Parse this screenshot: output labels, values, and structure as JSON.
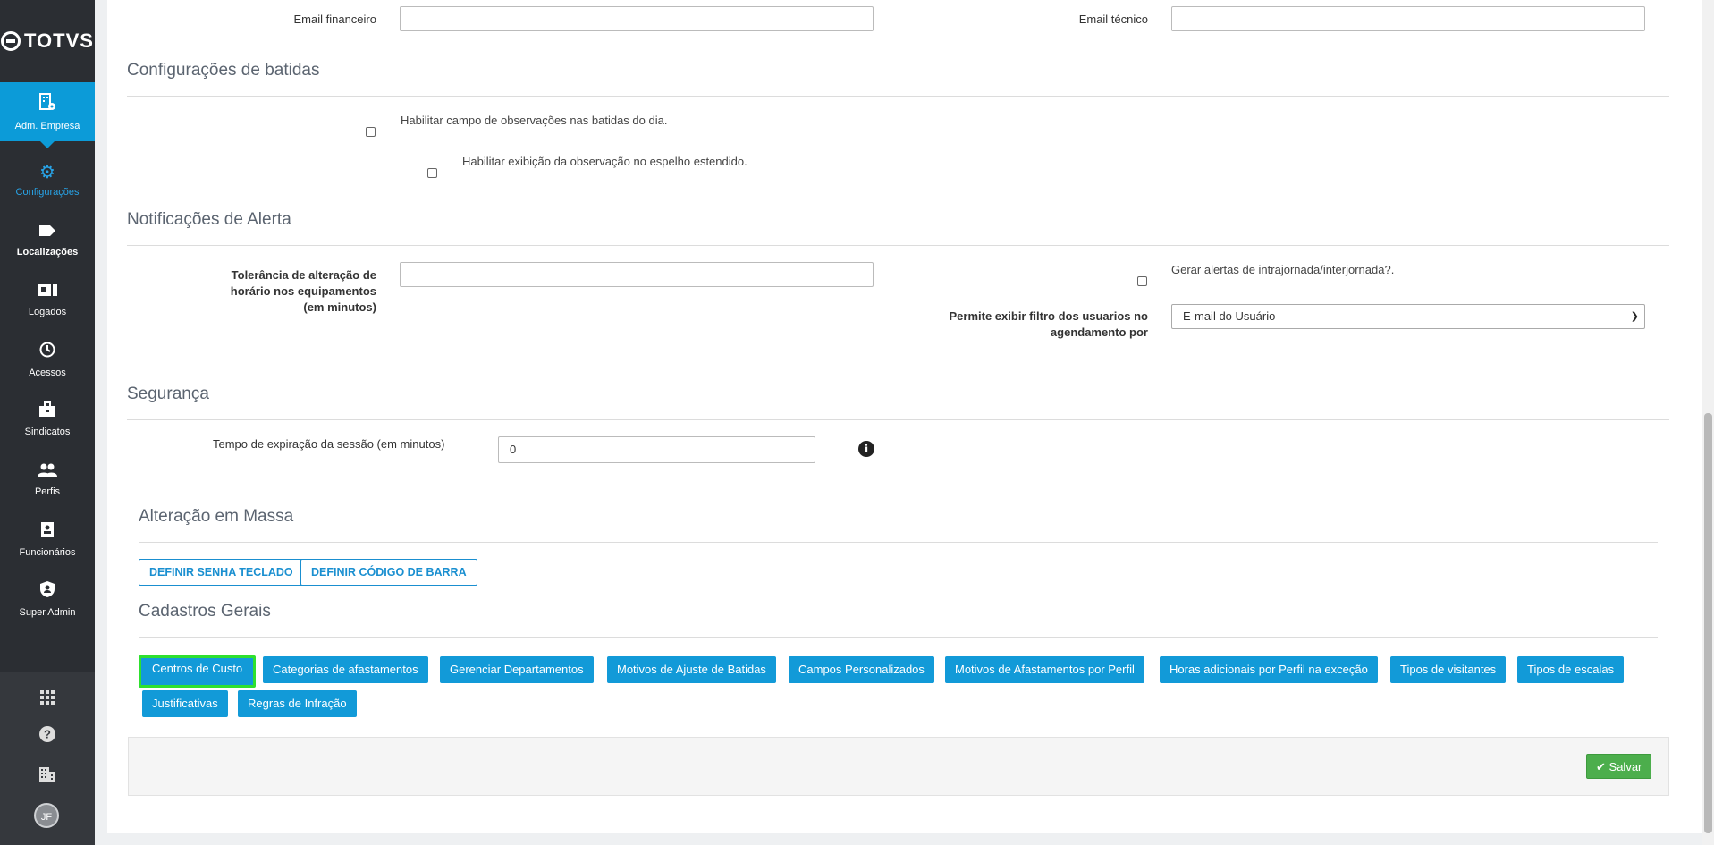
{
  "app": {
    "logo_text": "TOTVS"
  },
  "sidebar": {
    "items": [
      {
        "label": "Adm. Empresa",
        "icon": "building-gear-icon"
      },
      {
        "label": "Configurações",
        "icon": "gear-icon"
      },
      {
        "label": "Localizações",
        "icon": "tag-icon"
      },
      {
        "label": "Logados",
        "icon": "id-card-icon"
      },
      {
        "label": "Acessos",
        "icon": "history-icon"
      },
      {
        "label": "Sindicatos",
        "icon": "briefcase-icon"
      },
      {
        "label": "Perfis",
        "icon": "people-icon"
      },
      {
        "label": "Funcionários",
        "icon": "badge-icon"
      },
      {
        "label": "Super Admin",
        "icon": "shield-user-icon"
      }
    ],
    "bottom_icons": [
      "apps-grid-icon",
      "help-icon",
      "company-icon"
    ],
    "avatar_initials": "JF"
  },
  "contact": {
    "email_financeiro_label": "Email financeiro",
    "email_financeiro_value": "",
    "email_tecnico_label": "Email técnico",
    "email_tecnico_value": ""
  },
  "batidas": {
    "title": "Configurações de batidas",
    "check_observacoes_label": "Habilitar campo de observações nas batidas do dia.",
    "check_observacoes_checked": false,
    "check_espelho_label": "Habilitar exibição da observação no espelho estendido.",
    "check_espelho_checked": false
  },
  "alertas": {
    "title": "Notificações de Alerta",
    "tolerancia_label": "Tolerância de alteração de horário nos equipamentos (em minutos)",
    "tolerancia_value": "",
    "gerar_alertas_label": "Gerar alertas de intrajornada/interjornada?.",
    "gerar_alertas_checked": false,
    "filtro_label": "Permite exibir filtro dos usuarios no agendamento por",
    "filtro_value": "E-mail do Usuário"
  },
  "seguranca": {
    "title": "Segurança",
    "sessao_label": "Tempo de expiração da sessão (em minutos)",
    "sessao_value": "0",
    "info_icon": "info-icon"
  },
  "massa": {
    "title": "Alteração em Massa",
    "buttons": [
      "DEFINIR SENHA TECLADO",
      "DEFINIR CÓDIGO DE BARRA"
    ]
  },
  "cadastros": {
    "title": "Cadastros Gerais",
    "buttons": [
      "Centros de Custo",
      "Categorias de afastamentos",
      "Gerenciar Departamentos",
      "Motivos de Ajuste de Batidas",
      "Campos Personalizados",
      "Motivos de Afastamentos por Perfil",
      "Horas adicionais por Perfil na exceção",
      "Tipos de visitantes",
      "Tipos de escalas",
      "Justificativas",
      "Regras de Infração"
    ]
  },
  "footer": {
    "save_label": "Salvar",
    "save_icon": "check-icon"
  },
  "colors": {
    "brand_blue": "#129ad8",
    "sidebar_bg": "#2b2e33",
    "save_green": "#4cae4c",
    "highlight": "#2ee02e"
  }
}
